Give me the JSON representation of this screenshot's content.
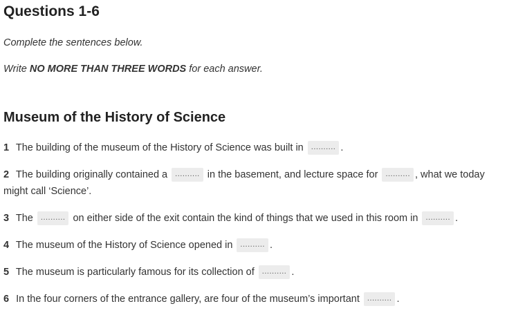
{
  "header": {
    "title": "Questions 1-6",
    "instruction_1": "Complete the sentences below.",
    "instruction_2_prefix": "Write ",
    "instruction_2_bold": "NO MORE THAN THREE WORDS",
    "instruction_2_suffix": " for each answer."
  },
  "section": {
    "title": "Museum of the History of Science"
  },
  "blank_placeholder": "..........",
  "questions": [
    {
      "number": "1",
      "text_a": "The building of the museum of the History of Science was built in",
      "text_b": "."
    },
    {
      "number": "2",
      "text_a": "The building originally contained a",
      "text_b": "in the basement, and lecture space for",
      "text_c": ", what we today might call ‘Science’."
    },
    {
      "number": "3",
      "text_a": "The",
      "text_b": "on either side of the exit contain the kind of things that we used in this room in",
      "text_c": "."
    },
    {
      "number": "4",
      "text_a": "The museum of the History of Science opened in",
      "text_b": "."
    },
    {
      "number": "5",
      "text_a": "The museum is particularly famous for its collection of",
      "text_b": "."
    },
    {
      "number": "6",
      "text_a": "In the four corners of the entrance gallery, are four of the museum’s important",
      "text_b": "."
    }
  ]
}
